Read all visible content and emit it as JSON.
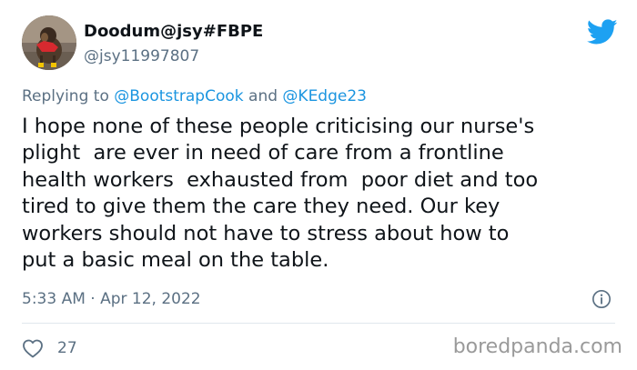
{
  "tweet": {
    "author": {
      "display_name": "Doodum@jsy#FBPE",
      "handle": "@jsy11997807",
      "avatar_icon": "dog-avatar"
    },
    "platform_icon": "twitter-bird-icon",
    "reply": {
      "prefix": "Replying to",
      "mention_1": "@BootstrapCook",
      "connector": "and",
      "mention_2": "@KEdge23"
    },
    "text_lines": [
      "I hope none of these people criticising our nurse's",
      "plight  are ever in need of care from a frontline",
      "health workers  exhausted from  poor diet and too",
      "tired to give them the care they need. Our key",
      "workers should not have to stress about how to",
      "put a basic meal on the table."
    ],
    "timestamp": "5:33 AM · Apr 12, 2022",
    "info_icon": "info-icon",
    "likes": "27"
  },
  "watermark": "boredpanda.com",
  "colors": {
    "text": "#0f1419",
    "secondary": "#5b7083",
    "link": "#1b95e0",
    "twitter_blue": "#1da1f2",
    "divider": "#e1e8ed"
  }
}
